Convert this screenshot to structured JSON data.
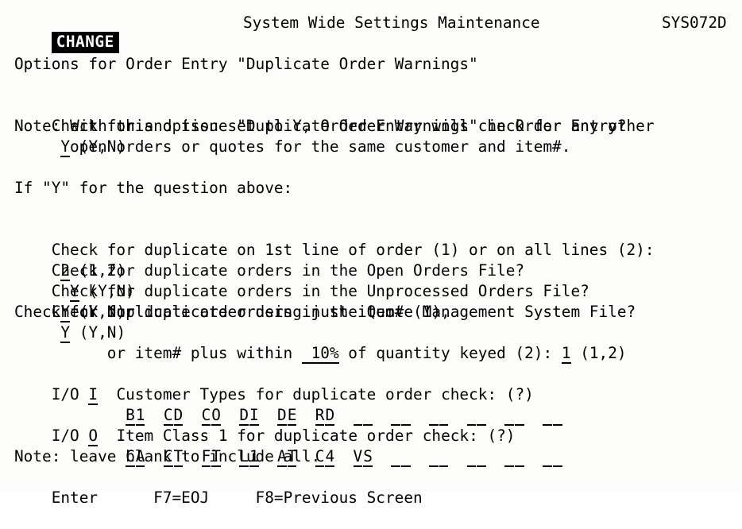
{
  "screen": {
    "mode_badge": "CHANGE",
    "title": "System Wide Settings Maintenance",
    "program_id": "SYS072D",
    "colors": {
      "background": "#fdfdfb",
      "foreground": "#000000",
      "reverse_video_bg": "#000000",
      "reverse_video_fg": "#ffffff"
    }
  },
  "body": {
    "section_heading": "Options for Order Entry \"Duplicate Order Warnings\"",
    "main_question": {
      "label": "Check for and issue \"Duplicate Order Warnings\" in Order Entry?",
      "value": "Y",
      "hint": "(Y,N)"
    },
    "note_line_1": "Note: With this option set to Y, Order Entry will check for any other",
    "note_line_2": "open orders or quotes for the same customer and item#.",
    "conditional_heading": "If \"Y\" for the question above:",
    "questions": [
      {
        "label": "Check for duplicate on 1st line of order (1) or on all lines (2):",
        "value": "2",
        "hint": "(1,2)"
      },
      {
        "label": "Check for duplicate orders in the Open Orders File?",
        "value": "Y",
        "hint": "(Y,N)",
        "lead_gap": "  "
      },
      {
        "label": "Check for duplicate orders in the Unprocessed Orders File?",
        "value": "Y",
        "hint": "(Y,N)",
        "lead_gap": " "
      },
      {
        "label": "Check for duplicate orders in the Quote Management System File?",
        "value": "Y",
        "hint": "(Y,N)",
        "lead_gap": " "
      }
    ],
    "item_rule": {
      "line_1": "Check for duplicate order using just item# (1),",
      "line_2_indent": "      ",
      "line_2_prefix": "or item# plus within ",
      "pct_value": " 10%",
      "line_2_middle": " of quantity keyed (2): ",
      "mode_value": "1",
      "line_2_hint": "(1,2)"
    },
    "customer_types": {
      "io_label": "I/O",
      "io_value": "I",
      "label": "Customer Types for duplicate order check:",
      "help_hint": "(?)",
      "slots_indent": "        ",
      "slots": [
        "B1",
        "CD",
        "CO",
        "DI",
        "DE",
        "RD",
        "  ",
        "  ",
        "  ",
        "  ",
        "  ",
        "  "
      ]
    },
    "item_class": {
      "io_label": "I/O",
      "io_value": "O",
      "label": "Item Class 1 for duplicate order check:",
      "help_hint": "(?)",
      "slots_indent": "        ",
      "slots": [
        "CA",
        "CT",
        "FT",
        "L1",
        "AT",
        "C4",
        "VS",
        "  ",
        "  ",
        "  ",
        "  ",
        "  "
      ]
    },
    "blank_note": "Note: leave blank to include all."
  },
  "footer": {
    "enter_label": "Enter",
    "gap_1": "      ",
    "f7_label": "F7=EOJ",
    "gap_2": "     ",
    "f8_label": "F8=Previous Screen"
  }
}
